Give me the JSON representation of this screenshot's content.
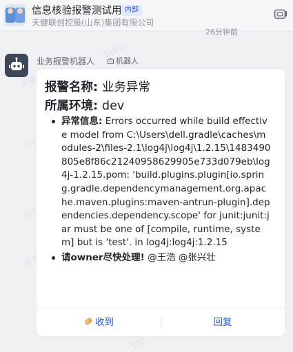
{
  "header": {
    "title": "信息核验报警测试用",
    "tag": "内部",
    "subtitle": "天健联创控股(山东)集团有限公司",
    "partial_time": "26分钟前"
  },
  "bot": {
    "name": "业务报警机器人",
    "tag": "机器人"
  },
  "card": {
    "alarm_label": "报警名称:",
    "alarm_value": "业务异常",
    "env_label": "所属环境:",
    "env_value": "dev",
    "error_label": "异常信息:",
    "error_text": "Errors occurred while build effective model from C:\\Users\\dell.gradle\\caches\\modules-2\\files-2.1\\log4j\\log4j\\1.2.15\\1483490805e8f86c21240958629905e733d079eb\\log4j-1.2.15.pom: 'build.plugins.plugin[io.spring.gradle.dependencymanagement.org.apache.maven.plugins:maven-antrun-plugin].dependencies.dependency.scope' for junit:junit:jar must be one of [compile, runtime, system] but is 'test'. in log4j:log4j:1.2.15",
    "owner_label": "请owner尽快处理!",
    "mention_1": "@王浩",
    "mention_2": "@张兴壮",
    "action_receive": "收到",
    "action_reply": "回复"
  },
  "colors": {
    "accent": "#245bdb",
    "tag_bg": "#e1eaff"
  }
}
